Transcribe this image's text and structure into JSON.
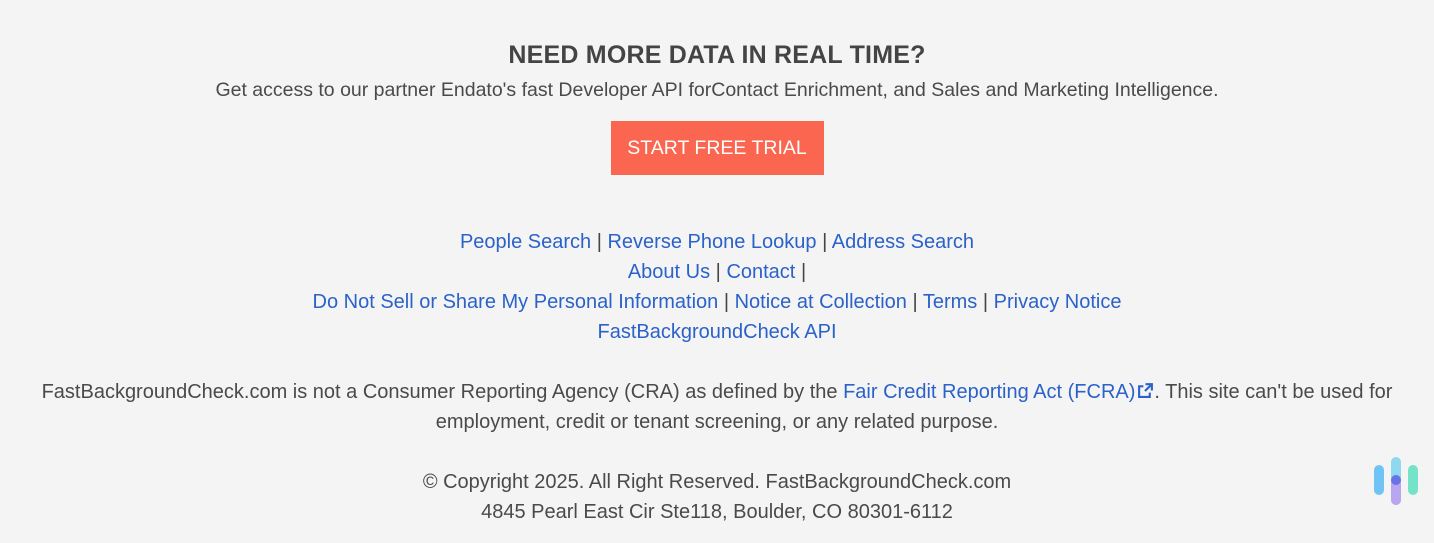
{
  "cta": {
    "title": "NEED MORE DATA IN REAL TIME?",
    "description": "Get access to our partner Endato's fast Developer API forContact Enrichment, and Sales and Marketing Intelligence.",
    "button_label": "START FREE TRIAL",
    "button_color": "#fa6650"
  },
  "footer_links": {
    "row1": [
      "People Search",
      "Reverse Phone Lookup",
      "Address Search"
    ],
    "row2": [
      "About Us",
      "Contact"
    ],
    "row3": [
      "Do Not Sell or Share My Personal Information",
      "Notice at Collection",
      "Terms",
      "Privacy Notice"
    ],
    "row4": [
      "FastBackgroundCheck API"
    ],
    "separator": "|",
    "link_color": "#2b62c9"
  },
  "disclaimer": {
    "before": "FastBackgroundCheck.com is not a Consumer Reporting Agency (CRA) as defined by the ",
    "link": "Fair Credit Reporting Act (FCRA)",
    "link_icon": "external-link-icon",
    "after": ". This site can't be used for",
    "line2": "employment, credit or tenant screening, or any related purpose."
  },
  "copyright": {
    "line1": "© Copyright 2025. All Right Reserved. FastBackgroundCheck.com",
    "line2": "4845 Pearl East Cir Ste118, Boulder, CO 80301-6112"
  },
  "widget": {
    "icon": "voice-assistant-icon"
  }
}
